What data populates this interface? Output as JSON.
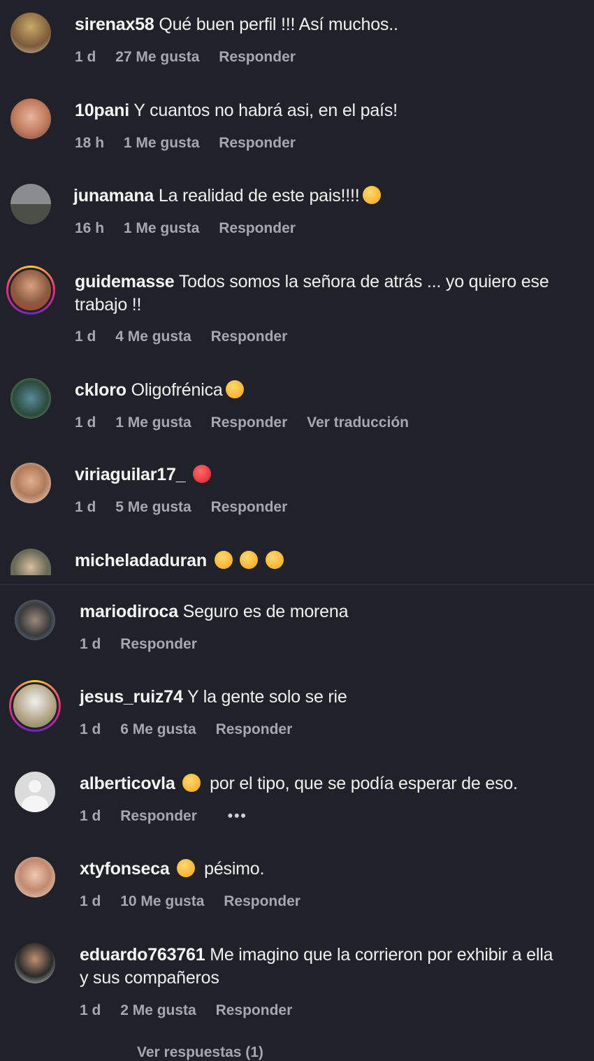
{
  "comments": [
    {
      "user": "sirenax58",
      "text": "Qué buen perfil !!! Así muchos..",
      "time": "1 d",
      "likes": "27 Me gusta",
      "reply": "Responder"
    },
    {
      "user": "10pani",
      "text": "Y cuantos no habrá asi, en el país!",
      "time": "18 h",
      "likes": "1 Me gusta",
      "reply": "Responder"
    },
    {
      "user": "junamana",
      "text": "La realidad de este pais!!!!",
      "time": "16 h",
      "likes": "1 Me gusta",
      "reply": "Responder"
    },
    {
      "user": "guidemasse",
      "text": "Todos somos la señora de atrás ... yo quiero ese",
      "text2": "trabajo !!",
      "time": "1 d",
      "likes": "4 Me gusta",
      "reply": "Responder"
    },
    {
      "user": "ckloro",
      "text": "Oligofrénica",
      "time": "1 d",
      "likes": "1 Me gusta",
      "reply": "Responder",
      "translate": "Ver traducción"
    },
    {
      "user": "viriaguilar17_",
      "text": "",
      "time": "1 d",
      "likes": "5 Me gusta",
      "reply": "Responder"
    },
    {
      "user": "micheladaduran",
      "text": ""
    },
    {
      "user": "mariodiroca",
      "text": "Seguro es de morena",
      "time": "1 d",
      "reply": "Responder"
    },
    {
      "user": "jesus_ruiz74",
      "text": "Y la gente solo se rie",
      "time": "1 d",
      "likes": "6 Me gusta",
      "reply": "Responder"
    },
    {
      "user": "alberticovla",
      "text": "por el tipo, que se podía esperar de eso.",
      "time": "1 d",
      "reply": "Responder",
      "more": "•••"
    },
    {
      "user": "xtyfonseca",
      "text": "pésimo.",
      "time": "1 d",
      "likes": "10 Me gusta",
      "reply": "Responder"
    },
    {
      "user": "eduardo763761",
      "text": "Me imagino que la corrieron por exhibir a ella",
      "text2": "y sus compañeros",
      "time": "1 d",
      "likes": "2 Me gusta",
      "reply": "Responder"
    }
  ],
  "more_replies": "Ver respuestas (1)",
  "colors": {
    "background": "#212229",
    "meta": "#a7a8ad",
    "text": "#f0f0f0"
  }
}
